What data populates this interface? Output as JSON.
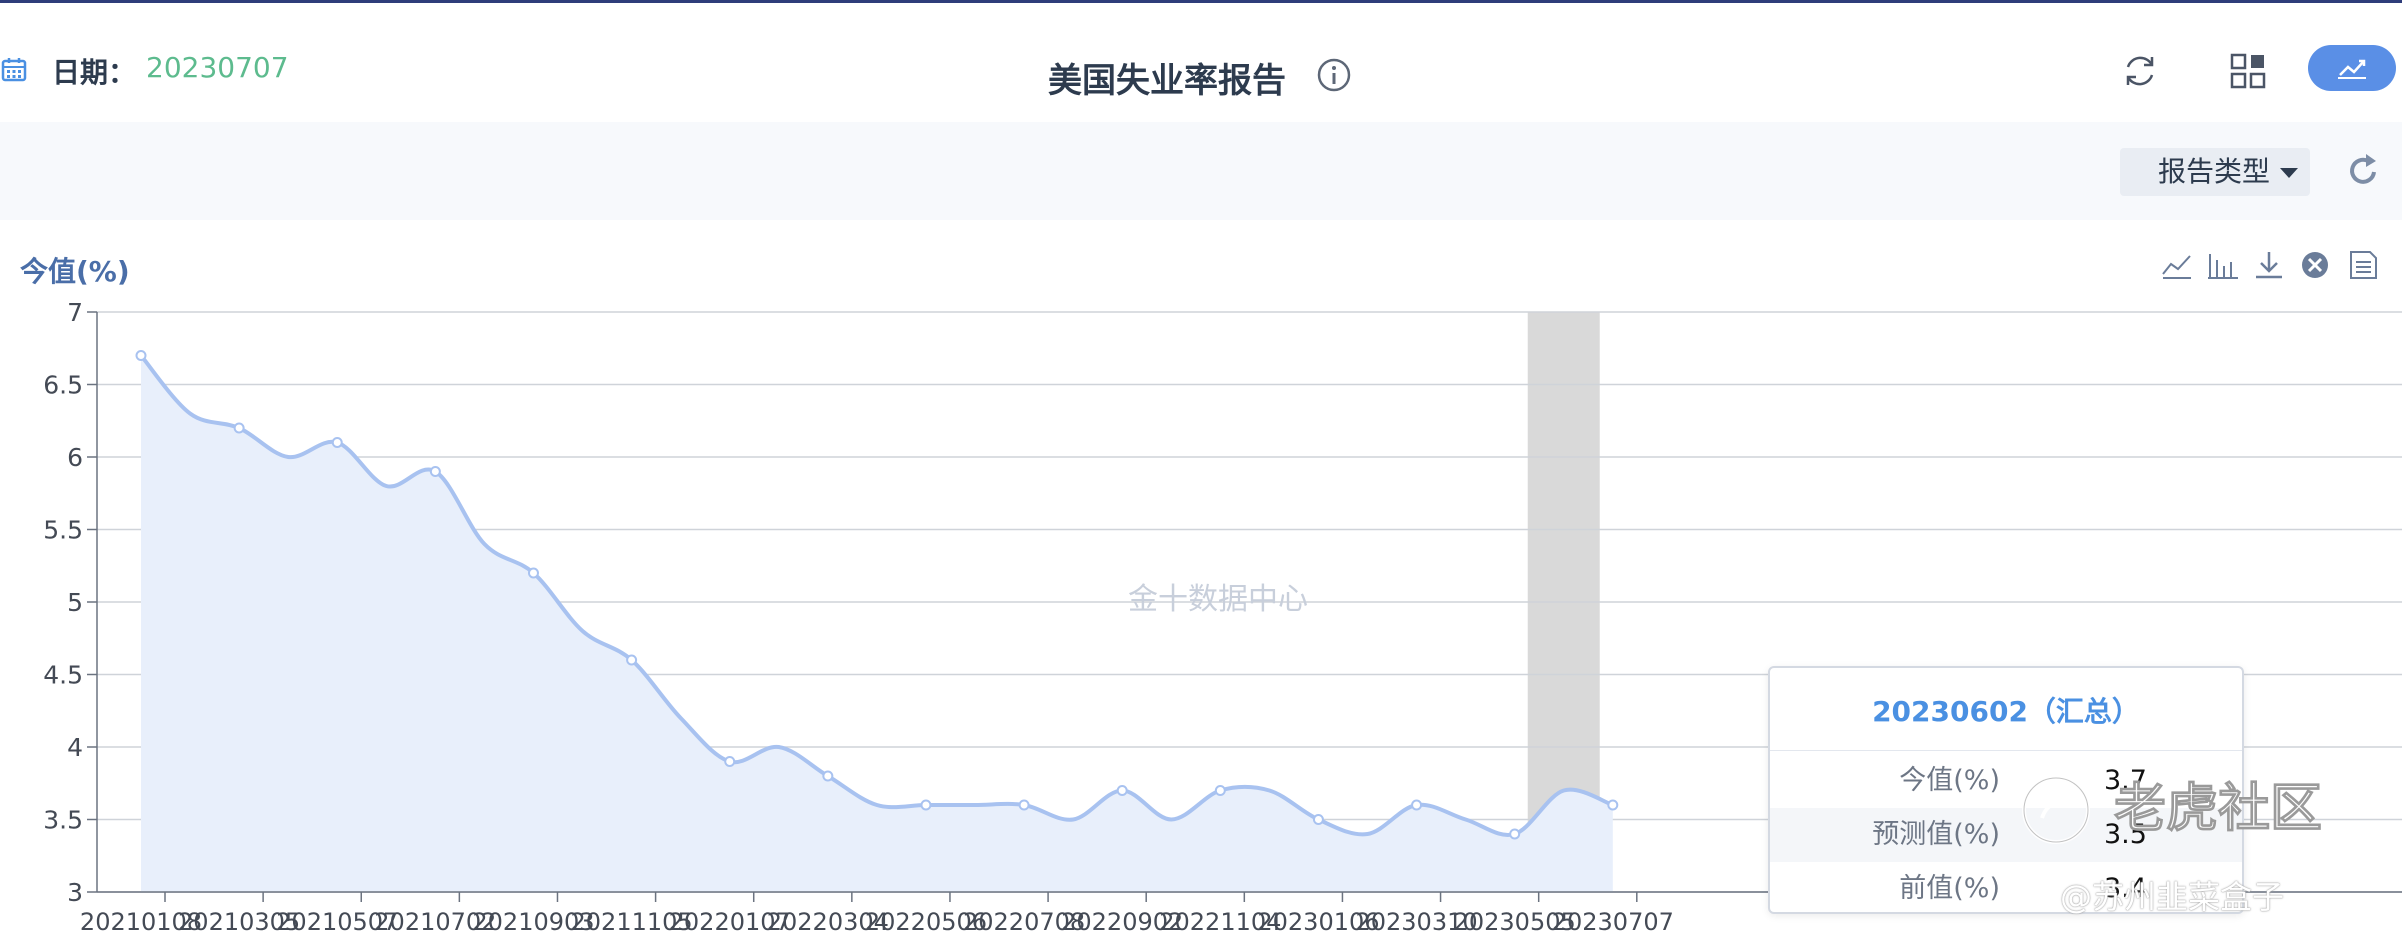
{
  "header": {
    "date_label": "日期：",
    "date_value": "20230707",
    "title": "美国失业率报告",
    "icons": [
      "calendar-icon",
      "info-icon",
      "refresh-icon",
      "grid-icon",
      "chart-icon"
    ]
  },
  "toolbar": {
    "report_type_label": "报告类型",
    "icons": [
      "caret-down-icon",
      "reload-icon"
    ]
  },
  "chart_tools": [
    "line-chart-icon",
    "bar-chart-icon",
    "download-icon",
    "close-circle-icon",
    "data-view-icon"
  ],
  "tooltip": {
    "title": "20230602（汇总）",
    "rows": [
      {
        "label": "今值(%)",
        "value": "3.7"
      },
      {
        "label": "预测值(%)",
        "value": "3.5"
      },
      {
        "label": "前值(%)",
        "value": "3.4"
      }
    ]
  },
  "watermarks": {
    "center": "金十数据中心",
    "logo": "老虎社区",
    "author": "@苏州韭菜盒子"
  },
  "chart_data": {
    "type": "area",
    "ylabel": "今值(%)",
    "ylim": [
      3,
      7
    ],
    "yticks": [
      3,
      3.5,
      4,
      4.5,
      5,
      5.5,
      6,
      6.5,
      7
    ],
    "yticklabels": [
      "3",
      "3.5",
      "4",
      "4.5",
      "5",
      "5.5",
      "6",
      "6.5",
      "7"
    ],
    "grid": true,
    "xticklabels": [
      "20210108",
      "20210305",
      "20210507",
      "20210702",
      "20210903",
      "20211105",
      "20220107",
      "20220304",
      "20220506",
      "20220708",
      "20220902",
      "20221104",
      "20230106",
      "20230310",
      "20230505",
      "20230707"
    ],
    "series": [
      {
        "x": [
          "20210108",
          "20210205",
          "20210305",
          "20210402",
          "20210507",
          "20210604",
          "20210702",
          "20210806",
          "20210903",
          "20211008",
          "20211105",
          "20211203",
          "20220107",
          "20220204",
          "20220304",
          "20220401",
          "20220506",
          "20220603",
          "20220708",
          "20220805",
          "20220902",
          "20221007",
          "20221104",
          "20221202",
          "20230106",
          "20230203",
          "20230310",
          "20230407",
          "20230505",
          "20230602",
          "20230707"
        ],
        "values": [
          6.7,
          6.3,
          6.2,
          6.0,
          6.1,
          5.8,
          5.9,
          5.4,
          5.2,
          4.8,
          4.6,
          4.2,
          3.9,
          4.0,
          3.8,
          3.6,
          3.6,
          3.6,
          3.6,
          3.5,
          3.7,
          3.5,
          3.7,
          3.7,
          3.5,
          3.4,
          3.6,
          3.5,
          3.4,
          3.7,
          3.6
        ],
        "color": "#a8c2f0",
        "fill": "#e8effb"
      }
    ],
    "highlight_category": "20230602",
    "highlight_color": "#d9d9d9"
  }
}
